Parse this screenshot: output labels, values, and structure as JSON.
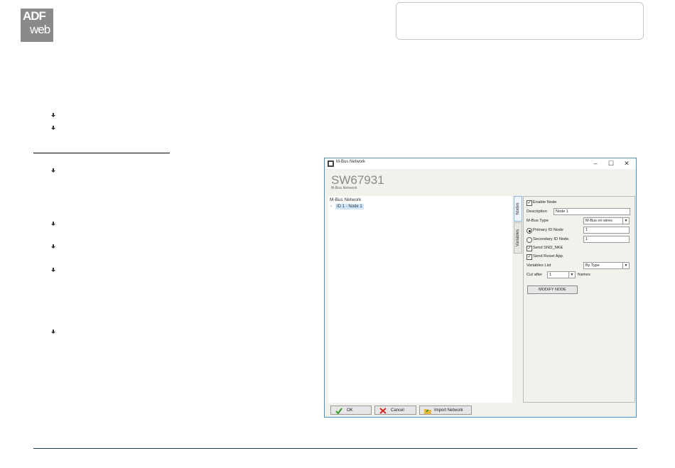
{
  "logo": {
    "line1": "ADF",
    "line2": "web"
  },
  "window": {
    "title": "M-Bus Network",
    "controls": {
      "minimize": "–",
      "maximize": "☐",
      "close": "✕"
    },
    "header_title": "SW67931",
    "header_subtitle": "M-Bus Network",
    "tree": {
      "root": "M-Bus Network",
      "arrow": "›",
      "node": "ID 1 - Node 1"
    },
    "tabs": [
      "Nodes",
      "Variables"
    ],
    "form": {
      "enable_node": "Enable Node",
      "description_label": "Description",
      "description_value": "Node 1",
      "mbus_type_label": "M-Bus Type",
      "mbus_type_value": "M-Bus on wires",
      "primary_id_label": "Primary ID Node",
      "primary_id_value": "1",
      "secondary_id_label": "Secondary ID Node",
      "secondary_id_value": "1",
      "send_snd_nke": "Send SND_NKE",
      "send_reset": "Send Reset App.",
      "variables_list_label": "Variables List",
      "variables_list_value": "By Type",
      "cut_after_label": "Cut after",
      "cut_after_value": "1",
      "frames_label": "frames",
      "modify_button": "MODIFY NODE"
    },
    "buttons": {
      "ok": "OK",
      "cancel": "Cancel",
      "import": "Import Network"
    }
  },
  "colors": {
    "accent": "#4a90c9",
    "selection": "#cfe6fb",
    "footer_line": "#1f3a5a"
  }
}
